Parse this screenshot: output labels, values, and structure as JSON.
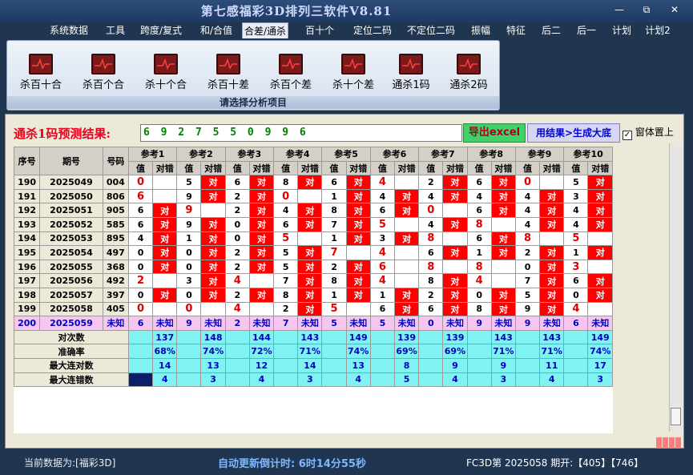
{
  "window": {
    "title": "第七感福彩3D排列三软件V8.81",
    "btn_min": "—",
    "btn_max": "⧉",
    "btn_close": "✕"
  },
  "menu": [
    "系统数据",
    "工具",
    "跨度/复式",
    "和/合值",
    "合差/通杀",
    "百十个",
    "定位二码",
    "不定位二码",
    "振幅",
    "特征",
    "后二",
    "后一",
    "计划",
    "计划2"
  ],
  "menu_active": 4,
  "ribbon": {
    "buttons": [
      "杀百十合",
      "杀百个合",
      "杀十个合",
      "杀百十差",
      "杀百个差",
      "杀十个差",
      "通杀1码",
      "通杀2码"
    ],
    "caption": "请选择分析项目"
  },
  "prediction": {
    "label": "通杀1码预测结果:",
    "value": "6 9 2 7 5 5 0 9 9 6",
    "export_label": "导出excel",
    "generate_label": "用结果>生成大底",
    "ontop_label": "窗体置上",
    "ontop_checked": "✓"
  },
  "table": {
    "headers": {
      "seq": "序号",
      "period": "期号",
      "number": "号码",
      "value": "值",
      "check": "对错"
    },
    "refs": [
      "参考1",
      "参考2",
      "参考3",
      "参考4",
      "参考5",
      "参考6",
      "参考7",
      "参考8",
      "参考9",
      "参考10"
    ],
    "dui": "对",
    "rows": [
      {
        "seq": "190",
        "period": "2025049",
        "num": "004",
        "vals": [
          "0",
          "5",
          "6",
          "8",
          "6",
          "4",
          "2",
          "6",
          "0",
          "5"
        ],
        "hits": [
          1,
          0,
          0,
          0,
          0,
          1,
          0,
          0,
          1,
          0
        ],
        "marks": [
          0,
          1,
          1,
          1,
          1,
          0,
          1,
          1,
          0,
          1
        ]
      },
      {
        "seq": "191",
        "period": "2025050",
        "num": "806",
        "vals": [
          "6",
          "9",
          "2",
          "0",
          "1",
          "4",
          "4",
          "4",
          "4",
          "3"
        ],
        "hits": [
          1,
          0,
          0,
          1,
          0,
          0,
          0,
          0,
          0,
          0
        ],
        "marks": [
          0,
          1,
          1,
          0,
          1,
          1,
          1,
          1,
          1,
          1
        ]
      },
      {
        "seq": "192",
        "period": "2025051",
        "num": "905",
        "vals": [
          "6",
          "9",
          "2",
          "4",
          "8",
          "6",
          "0",
          "6",
          "4",
          "4"
        ],
        "hits": [
          0,
          1,
          0,
          0,
          0,
          0,
          1,
          0,
          0,
          0
        ],
        "marks": [
          1,
          0,
          1,
          1,
          1,
          1,
          0,
          1,
          1,
          1
        ]
      },
      {
        "seq": "193",
        "period": "2025052",
        "num": "585",
        "vals": [
          "6",
          "9",
          "0",
          "6",
          "7",
          "5",
          "4",
          "8",
          "4",
          "4"
        ],
        "hits": [
          0,
          0,
          0,
          0,
          0,
          1,
          0,
          1,
          0,
          0
        ],
        "marks": [
          1,
          1,
          1,
          1,
          1,
          0,
          1,
          0,
          1,
          1
        ]
      },
      {
        "seq": "194",
        "period": "2025053",
        "num": "895",
        "vals": [
          "4",
          "1",
          "0",
          "5",
          "1",
          "3",
          "8",
          "6",
          "8",
          "5"
        ],
        "hits": [
          0,
          0,
          0,
          1,
          0,
          0,
          1,
          0,
          1,
          1
        ],
        "marks": [
          1,
          1,
          1,
          0,
          1,
          1,
          0,
          1,
          0,
          0
        ]
      },
      {
        "seq": "195",
        "period": "2025054",
        "num": "497",
        "vals": [
          "0",
          "0",
          "2",
          "5",
          "7",
          "4",
          "6",
          "1",
          "2",
          "1"
        ],
        "hits": [
          0,
          0,
          0,
          0,
          1,
          1,
          0,
          0,
          0,
          0
        ],
        "marks": [
          1,
          1,
          1,
          1,
          0,
          0,
          1,
          1,
          1,
          1
        ]
      },
      {
        "seq": "196",
        "period": "2025055",
        "num": "368",
        "vals": [
          "0",
          "0",
          "2",
          "5",
          "2",
          "6",
          "8",
          "8",
          "0",
          "3"
        ],
        "hits": [
          0,
          0,
          0,
          0,
          0,
          1,
          1,
          1,
          0,
          1
        ],
        "marks": [
          1,
          1,
          1,
          1,
          1,
          0,
          0,
          0,
          1,
          0
        ]
      },
      {
        "seq": "197",
        "period": "2025056",
        "num": "492",
        "vals": [
          "2",
          "3",
          "4",
          "7",
          "8",
          "4",
          "8",
          "4",
          "7",
          "6"
        ],
        "hits": [
          1,
          0,
          1,
          0,
          0,
          1,
          0,
          1,
          0,
          0
        ],
        "marks": [
          0,
          1,
          0,
          1,
          1,
          0,
          1,
          0,
          1,
          1
        ]
      },
      {
        "seq": "198",
        "period": "2025057",
        "num": "397",
        "vals": [
          "0",
          "0",
          "2",
          "8",
          "1",
          "1",
          "2",
          "0",
          "5",
          "0"
        ],
        "hits": [
          0,
          0,
          0,
          0,
          0,
          0,
          0,
          0,
          0,
          0
        ],
        "marks": [
          1,
          1,
          1,
          1,
          1,
          1,
          1,
          1,
          1,
          1
        ]
      },
      {
        "seq": "199",
        "period": "2025058",
        "num": "405",
        "vals": [
          "0",
          "0",
          "4",
          "2",
          "5",
          "6",
          "6",
          "8",
          "9",
          "4"
        ],
        "hits": [
          1,
          1,
          1,
          0,
          1,
          0,
          0,
          0,
          0,
          1
        ],
        "marks": [
          0,
          0,
          0,
          1,
          0,
          1,
          1,
          1,
          1,
          0
        ]
      }
    ],
    "unknown_row": {
      "seq": "200",
      "period": "2025059",
      "num": "未知",
      "vals": [
        "6",
        "9",
        "2",
        "7",
        "5",
        "5",
        "0",
        "9",
        "9",
        "6"
      ],
      "mark": "未知"
    },
    "stats": [
      {
        "label": "对次数",
        "vals": [
          "137",
          "148",
          "144",
          "143",
          "149",
          "139",
          "139",
          "143",
          "143",
          "149"
        ]
      },
      {
        "label": "准确率",
        "vals": [
          "68%",
          "74%",
          "72%",
          "71%",
          "74%",
          "69%",
          "69%",
          "71%",
          "71%",
          "74%"
        ]
      },
      {
        "label": "最大连对数",
        "vals": [
          "14",
          "13",
          "12",
          "14",
          "13",
          "8",
          "9",
          "9",
          "11",
          "17"
        ]
      },
      {
        "label": "最大连错数",
        "vals": [
          "4",
          "3",
          "4",
          "3",
          "4",
          "5",
          "4",
          "3",
          "4",
          "3"
        ]
      }
    ]
  },
  "status": {
    "left": "当前数据为:[福彩3D]",
    "countdown": "自动更新倒计时: 6时14分55秒",
    "right": "FC3D第 2025058 期开:【405】【746】"
  }
}
